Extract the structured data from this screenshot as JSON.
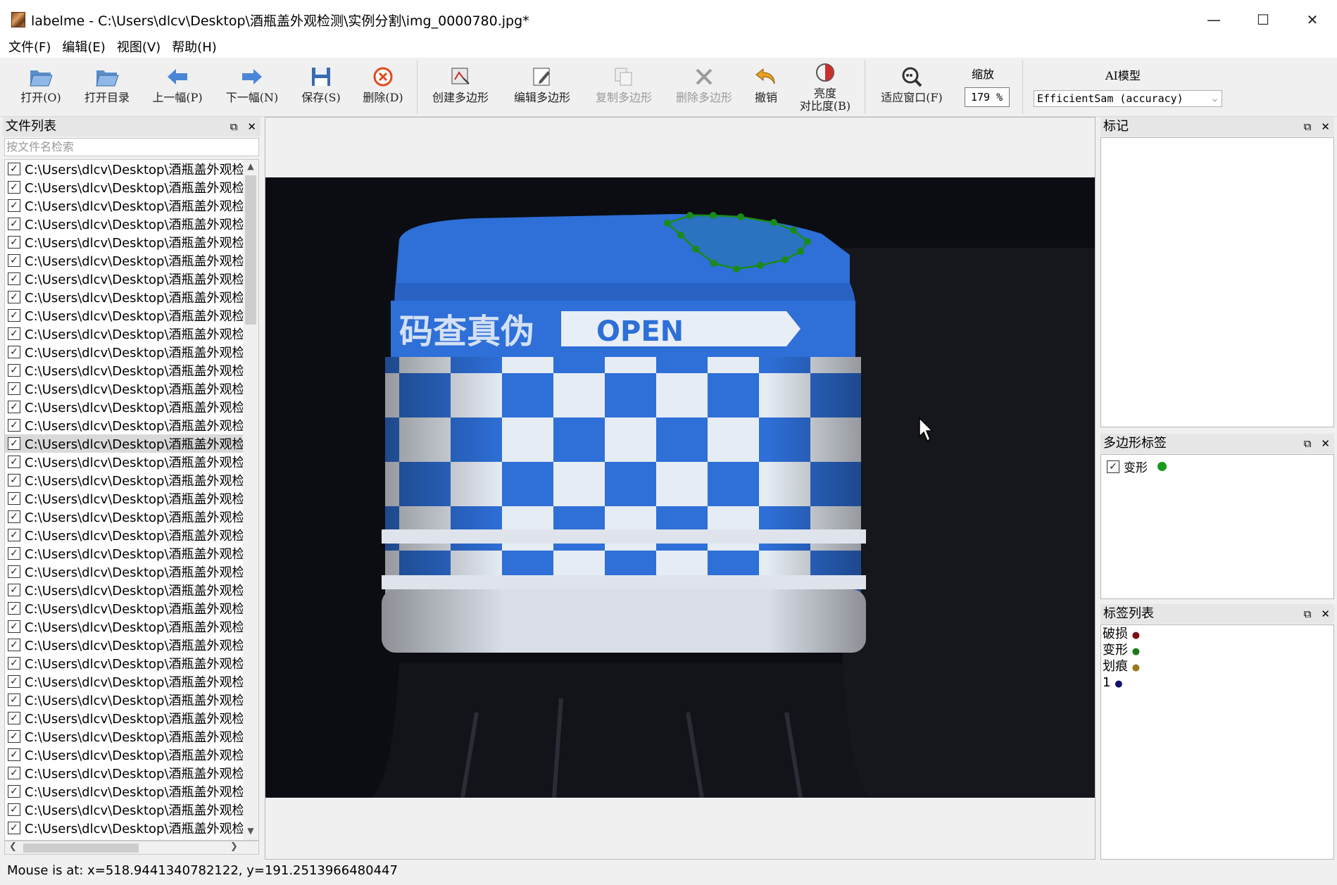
{
  "window": {
    "title": "labelme - C:\\Users\\dlcv\\Desktop\\酒瓶盖外观检测\\实例分割\\img_0000780.jpg*",
    "minimize": "—",
    "maximize": "☐",
    "close": "✕"
  },
  "menu": [
    "文件(F)",
    "编辑(E)",
    "视图(V)",
    "帮助(H)"
  ],
  "toolbar": {
    "open": "打开(O)",
    "open_dir": "打开目录",
    "prev": "上一幅(P)",
    "next": "下一幅(N)",
    "save": "保存(S)",
    "delete": "删除(D)",
    "create_polygon": "创建多边形",
    "edit_polygon": "编辑多边形",
    "copy_polygon": "复制多边形",
    "delete_polygon": "删除多边形",
    "undo": "撤销",
    "brightness_line1": "亮度",
    "brightness_line2": "对比度(B)",
    "fit_window": "适应窗口(F)",
    "zoom_label": "缩放",
    "zoom_value": "179 %",
    "ai_label": "AI模型",
    "ai_model": "EfficientSam (accuracy)"
  },
  "file_panel": {
    "title": "文件列表",
    "search_placeholder": "按文件名检索",
    "item_text": "C:\\Users\\dlcv\\Desktop\\酒瓶盖外观检",
    "item_count": 37,
    "selected_index": 15
  },
  "marks_panel": {
    "title": "标记"
  },
  "polygon_panel": {
    "title": "多边形标签",
    "items": [
      {
        "label": "变形",
        "color": "#1a9a1a",
        "checked": true
      }
    ]
  },
  "label_list_panel": {
    "title": "标签列表",
    "items": [
      {
        "label": "破损",
        "color": "#7a1010"
      },
      {
        "label": "变形",
        "color": "#1a7a1a"
      },
      {
        "label": "划痕",
        "color": "#9a7a20"
      },
      {
        "label": "1",
        "color": "#101070"
      }
    ]
  },
  "canvas": {
    "cap_text_cn": "码查真伪",
    "cap_text_open": "OPEN",
    "annotation_color": "#1a8a1a"
  },
  "status": "Mouse is at: x=518.9441340782122, y=191.2513966480447",
  "colors": {
    "cap_blue": "#2e6fd8",
    "accent": "#1a8a1a"
  }
}
